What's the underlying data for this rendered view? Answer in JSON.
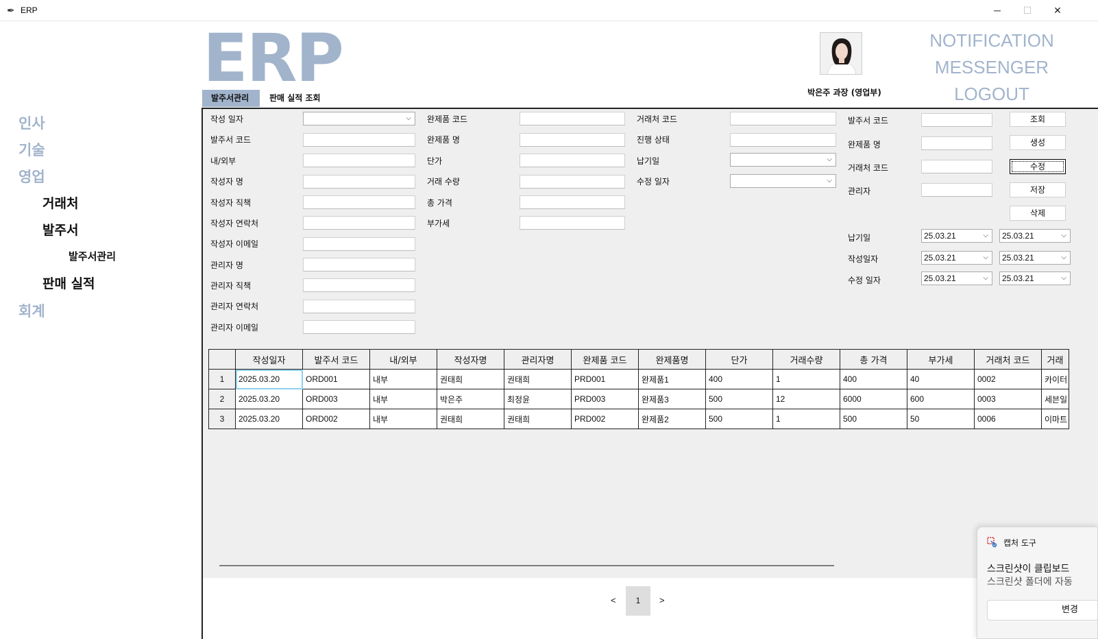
{
  "window": {
    "title": "ERP",
    "minimize": "─",
    "maximize": "☐",
    "close": "✕"
  },
  "sidebar": {
    "hr": "인사",
    "tech": "기술",
    "sales": "영업",
    "client": "거래처",
    "order": "발주서",
    "order_manage": "발주서관리",
    "sales_perf": "판매 실적",
    "accounting": "회계"
  },
  "header": {
    "logo": "ERP",
    "user": "박은주 과장 (영업부)",
    "nav": [
      "NOTIFICATION",
      "MESSENGER",
      "LOGOUT"
    ]
  },
  "tabs": [
    "발주서관리",
    "판매 실적 조회"
  ],
  "form": {
    "col1": [
      "작성 일자",
      "발주서 코드",
      "내/외부",
      "작성자 명",
      "작성자 직책",
      "작성자 연락처",
      "작성자 이메일",
      "관리자 명",
      "관리자 직책",
      "관리자 연락처",
      "관리자 이메일"
    ],
    "col2": [
      "완제품 코드",
      "완제품 명",
      "단가",
      "거래 수량",
      "총 가격",
      "부가세"
    ],
    "col3": [
      "거래처 코드",
      "진행 상태",
      "납기일",
      "수정 일자"
    ]
  },
  "search": {
    "labels": [
      "발주서 코드",
      "완제품 명",
      "거래처 코드",
      "관리자"
    ],
    "buttons": [
      "조회",
      "생성",
      "수정",
      "저장",
      "삭제"
    ],
    "date_labels": [
      "납기일",
      "작성일자",
      "수정 일자"
    ],
    "date_value": "25.03.21"
  },
  "table": {
    "headers": [
      "",
      "작성일자",
      "발주서 코드",
      "내/외부",
      "작성자명",
      "관리자명",
      "완제품 코드",
      "완제품명",
      "단가",
      "거래수량",
      "총 가격",
      "부가세",
      "거래처 코드",
      "거래"
    ],
    "rows": [
      [
        "1",
        "2025.03.20",
        "ORD001",
        "내부",
        "권태희",
        "권태희",
        "PRD001",
        "완제품1",
        "400",
        "1",
        "400",
        "40",
        "0002",
        "카이터"
      ],
      [
        "2",
        "2025.03.20",
        "ORD003",
        "내부",
        "박은주",
        "최정윤",
        "PRD003",
        "완제품3",
        "500",
        "12",
        "6000",
        "600",
        "0003",
        "세븐일"
      ],
      [
        "3",
        "2025.03.20",
        "ORD002",
        "내부",
        "권태희",
        "권태희",
        "PRD002",
        "완제품2",
        "500",
        "1",
        "500",
        "50",
        "0006",
        "이마트"
      ]
    ]
  },
  "pager": {
    "prev": "<",
    "current": "1",
    "next": ">"
  },
  "toast": {
    "app": "캡처 도구",
    "line1": "스크린샷이 클립보드",
    "line2": "스크린샷 폴더에 자동",
    "button": "변경"
  }
}
